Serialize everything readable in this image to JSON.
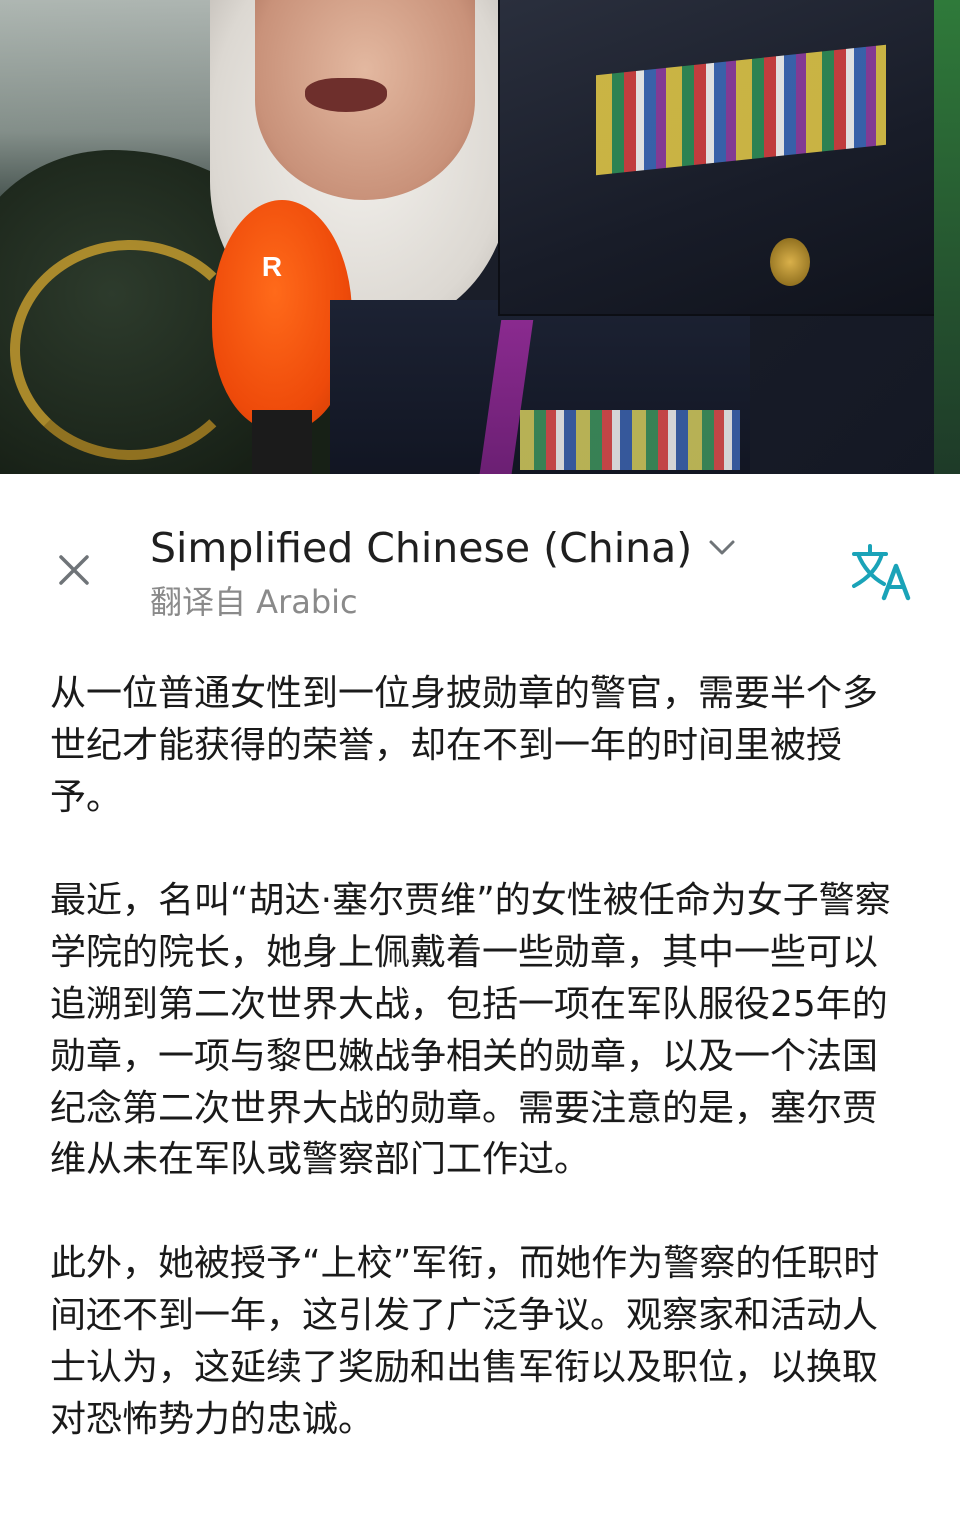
{
  "photo": {
    "mic_logo": "R"
  },
  "translation_panel": {
    "target_language": "Simplified Chinese (China)",
    "source_label": "翻译自 Arabic",
    "icons": {
      "close": "close-icon",
      "dropdown": "chevron-down-icon",
      "translate": "translate-icon"
    },
    "accent_color": "#1aa3b8"
  },
  "content": {
    "paragraphs": [
      "从一位普通女性到一位身披勋章的警官，需要半个多世纪才能获得的荣誉，却在不到一年的时间里被授予。",
      "最近，名叫“胡达·塞尔贾维”的女性被任命为女子警察学院的院长，她身上佩戴着一些勋章，其中一些可以追溯到第二次世界大战，包括一项在军队服役25年的勋章，一项与黎巴嫩战争相关的勋章，以及一个法国纪念第二次世界大战的勋章。需要注意的是，塞尔贾维从未在军队或警察部门工作过。",
      "此外，她被授予“上校”军衔，而她作为警察的任职时间还不到一年，这引发了广泛争议。观察家和活动人士认为，这延续了奖励和出售军衔以及职位，以换取对恐怖势力的忠诚。"
    ]
  }
}
